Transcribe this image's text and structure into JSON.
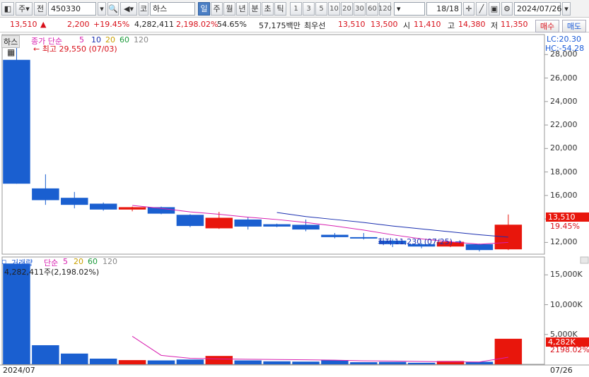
{
  "toolbar": {
    "chart_type": "주",
    "prefix": "전",
    "code": "450330",
    "market_prefix": "코",
    "name": "하스",
    "intervals": [
      "일",
      "주",
      "월",
      "년",
      "분",
      "초",
      "틱"
    ],
    "active_interval": "일",
    "periods": [
      "1",
      "3",
      "5",
      "10",
      "20",
      "30",
      "60",
      "120"
    ],
    "page": "18/18",
    "date": "2024/07/26"
  },
  "info": {
    "price": "13,510",
    "direction": "▲",
    "change": "2,200",
    "change_pct": "+19.45%",
    "volume": "4,282,411",
    "volume_pct": "2,198.02%",
    "turnover_pct": "54.65%",
    "amount": "57,175백만",
    "priority_label": "최우선",
    "ask": "13,510",
    "bid": "13,500",
    "open_label": "시",
    "open": "11,410",
    "high_label": "고",
    "high": "14,380",
    "low_label": "저",
    "low": "11,350",
    "buy_label": "매수",
    "sell_label": "매도"
  },
  "price_panel": {
    "name": "하스",
    "ma_label": "종가 단순",
    "ma_periods": [
      "5",
      "10",
      "20",
      "60",
      "120"
    ],
    "max_label": "최고 29,550 (07/03)",
    "min_label": "최저 11,230 (07/25)",
    "lc": "LC:20.30",
    "hc": "HC:-54.28",
    "current_price": "13,510",
    "current_pct": "19.45%",
    "y_ticks": [
      "28,000",
      "26,000",
      "24,000",
      "22,000",
      "20,000",
      "18,000",
      "16,000",
      "14,000",
      "12,000"
    ]
  },
  "volume_panel": {
    "label": "거래량",
    "ma_label": "단순",
    "ma_periods": [
      "5",
      "20",
      "60",
      "120"
    ],
    "max_label": "4,282,411주(2,198.02%)",
    "current_volume": "4,282K",
    "current_pct": "2198.02%",
    "y_ticks": [
      "15,000K",
      "10,000K",
      "5,000K"
    ]
  },
  "x_axis": {
    "start": "2024/07",
    "end": "07/26"
  },
  "colors": {
    "up": "#e8160c",
    "down": "#1a5fd0",
    "ma5": "#d81fb0",
    "ma10": "#1a2fb0",
    "ma20": "#c8a000",
    "ma60": "#1a9a3a"
  },
  "chart_data": {
    "type": "candlestick",
    "candles": [
      {
        "o": 27550,
        "h": 29550,
        "l": 17000,
        "c": 17000,
        "v": 16900
      },
      {
        "o": 16600,
        "h": 17800,
        "l": 15200,
        "c": 15600,
        "v": 3200
      },
      {
        "o": 15800,
        "h": 16300,
        "l": 14900,
        "c": 15200,
        "v": 1800
      },
      {
        "o": 15300,
        "h": 15400,
        "l": 14700,
        "c": 14800,
        "v": 950
      },
      {
        "o": 14800,
        "h": 15050,
        "l": 14650,
        "c": 15000,
        "v": 700
      },
      {
        "o": 15000,
        "h": 15050,
        "l": 14400,
        "c": 14450,
        "v": 650
      },
      {
        "o": 14350,
        "h": 14400,
        "l": 13300,
        "c": 13400,
        "v": 800
      },
      {
        "o": 13200,
        "h": 14600,
        "l": 13150,
        "c": 14100,
        "v": 1400
      },
      {
        "o": 13950,
        "h": 14150,
        "l": 13100,
        "c": 13350,
        "v": 650
      },
      {
        "o": 13550,
        "h": 13600,
        "l": 13300,
        "c": 13350,
        "v": 500
      },
      {
        "o": 13500,
        "h": 13950,
        "l": 12950,
        "c": 13100,
        "v": 450
      },
      {
        "o": 12650,
        "h": 12800,
        "l": 12350,
        "c": 12450,
        "v": 700
      },
      {
        "o": 12450,
        "h": 12800,
        "l": 12250,
        "c": 12350,
        "v": 350
      },
      {
        "o": 12150,
        "h": 12300,
        "l": 11600,
        "c": 11850,
        "v": 400
      },
      {
        "o": 11850,
        "h": 11950,
        "l": 11500,
        "c": 11650,
        "v": 250
      },
      {
        "o": 11650,
        "h": 12150,
        "l": 11600,
        "c": 12050,
        "v": 550
      },
      {
        "o": 11850,
        "h": 11900,
        "l": 11230,
        "c": 11350,
        "v": 420
      },
      {
        "o": 11410,
        "h": 14380,
        "l": 11350,
        "c": 13510,
        "v": 4282
      }
    ],
    "ma5": [
      null,
      null,
      null,
      null,
      15150,
      14900,
      14600,
      14400,
      14150,
      13950,
      13700,
      13400,
      13050,
      12650,
      12300,
      12050,
      11850,
      12000
    ],
    "ma10": [
      null,
      null,
      null,
      null,
      null,
      null,
      null,
      null,
      null,
      14550,
      14200,
      13950,
      13700,
      13400,
      13150,
      12900,
      12650,
      12450
    ],
    "vol_ma5": [
      null,
      null,
      null,
      null,
      4700,
      1500,
      1000,
      900,
      850,
      800,
      750,
      700,
      580,
      550,
      480,
      420,
      380,
      1180
    ],
    "ylim": [
      11000,
      29700
    ],
    "vol_ylim": [
      0,
      18000
    ]
  }
}
